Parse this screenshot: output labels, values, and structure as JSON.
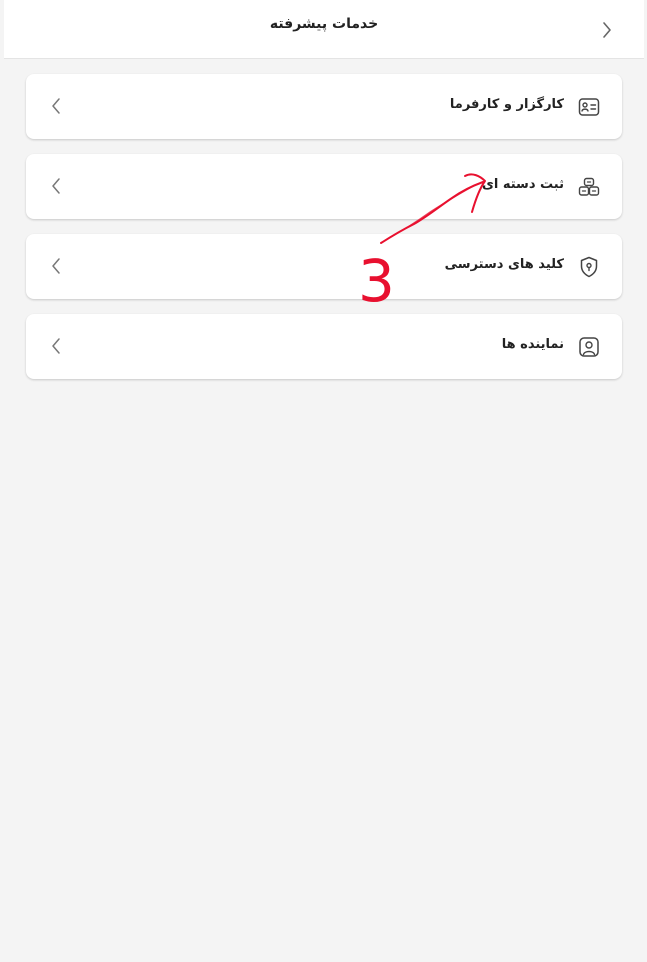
{
  "header": {
    "title": "خدمات پیشرفته",
    "back_icon": "chevron-left-icon"
  },
  "menu": {
    "items": [
      {
        "label": "کارگزار و کارفرما",
        "icon": "id-card-icon"
      },
      {
        "label": "ثبت دسته ای",
        "icon": "boxes-icon"
      },
      {
        "label": "کلید های دسترسی",
        "icon": "shield-key-icon"
      },
      {
        "label": "نماینده ها",
        "icon": "user-square-icon"
      }
    ],
    "chevron_icon": "chevron-left-icon"
  },
  "annotation": {
    "number": "3",
    "color": "#e8102f"
  }
}
